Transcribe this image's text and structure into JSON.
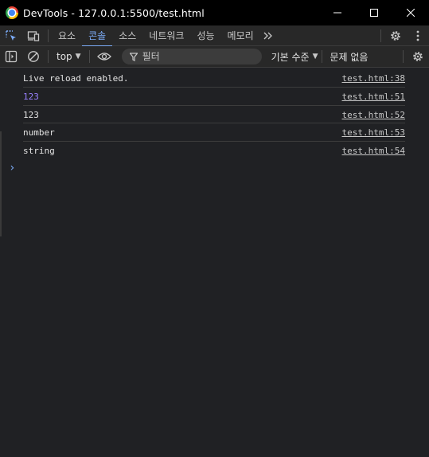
{
  "window": {
    "title": "DevTools - 127.0.0.1:5500/test.html"
  },
  "main_toolbar": {
    "tabs": [
      {
        "label": "요소"
      },
      {
        "label": "콘솔",
        "active": true
      },
      {
        "label": "소스"
      },
      {
        "label": "네트워크"
      },
      {
        "label": "성능"
      },
      {
        "label": "메모리"
      }
    ]
  },
  "console_toolbar": {
    "context": "top",
    "filter_placeholder": "필터",
    "levels": "기본 수준",
    "issues": "문제 없음"
  },
  "messages": [
    {
      "text": "Live reload enabled.",
      "source": "test.html:38",
      "type": "string"
    },
    {
      "text": "123",
      "source": "test.html:51",
      "type": "number"
    },
    {
      "text": "123",
      "source": "test.html:52",
      "type": "string"
    },
    {
      "text": "number",
      "source": "test.html:53",
      "type": "string"
    },
    {
      "text": "string",
      "source": "test.html:54",
      "type": "string"
    }
  ],
  "prompt_symbol": "›",
  "colors": {
    "accent": "#7cacf8",
    "number_value": "#9980ff",
    "background": "#202124"
  }
}
